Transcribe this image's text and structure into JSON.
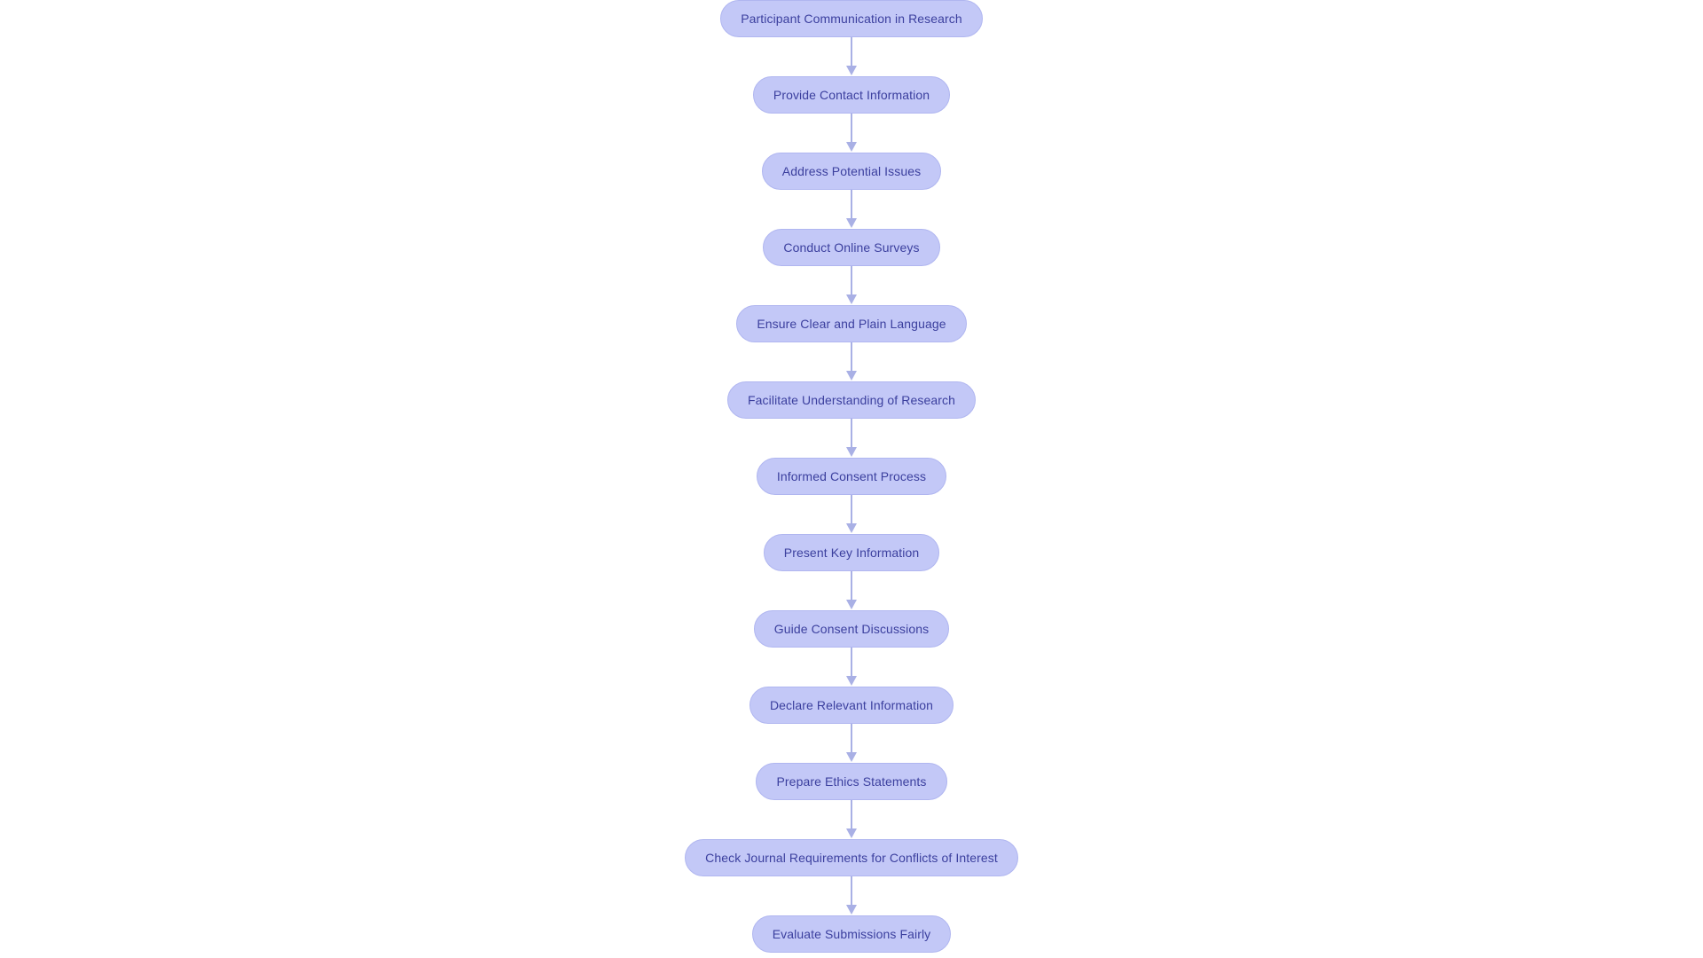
{
  "diagram": {
    "type": "flowchart",
    "orientation": "vertical-top-to-bottom",
    "background_color": "#ffffff",
    "node_fill_color": "#c3c8f7",
    "node_border_color": "#b0b6f0",
    "node_text_color": "#3b3f9e",
    "connector_color": "#a9b0e5",
    "node_shape": "rounded-pill",
    "nodes": [
      {
        "id": "n1",
        "label": "Participant Communication in Research"
      },
      {
        "id": "n2",
        "label": "Provide Contact Information"
      },
      {
        "id": "n3",
        "label": "Address Potential Issues"
      },
      {
        "id": "n4",
        "label": "Conduct Online Surveys"
      },
      {
        "id": "n5",
        "label": "Ensure Clear and Plain Language"
      },
      {
        "id": "n6",
        "label": "Facilitate Understanding of Research"
      },
      {
        "id": "n7",
        "label": "Informed Consent Process"
      },
      {
        "id": "n8",
        "label": "Present Key Information"
      },
      {
        "id": "n9",
        "label": "Guide Consent Discussions"
      },
      {
        "id": "n10",
        "label": "Declare Relevant Information"
      },
      {
        "id": "n11",
        "label": "Prepare Ethics Statements"
      },
      {
        "id": "n12",
        "label": "Check Journal Requirements for Conflicts of Interest"
      },
      {
        "id": "n13",
        "label": "Evaluate Submissions Fairly"
      }
    ],
    "edges": [
      {
        "from": "n1",
        "to": "n2",
        "arrow": "down"
      },
      {
        "from": "n2",
        "to": "n3",
        "arrow": "down"
      },
      {
        "from": "n3",
        "to": "n4",
        "arrow": "down"
      },
      {
        "from": "n4",
        "to": "n5",
        "arrow": "down"
      },
      {
        "from": "n5",
        "to": "n6",
        "arrow": "down"
      },
      {
        "from": "n6",
        "to": "n7",
        "arrow": "down"
      },
      {
        "from": "n7",
        "to": "n8",
        "arrow": "down"
      },
      {
        "from": "n8",
        "to": "n9",
        "arrow": "down"
      },
      {
        "from": "n9",
        "to": "n10",
        "arrow": "down"
      },
      {
        "from": "n10",
        "to": "n11",
        "arrow": "down"
      },
      {
        "from": "n11",
        "to": "n12",
        "arrow": "down"
      },
      {
        "from": "n12",
        "to": "n13",
        "arrow": "down"
      }
    ]
  }
}
